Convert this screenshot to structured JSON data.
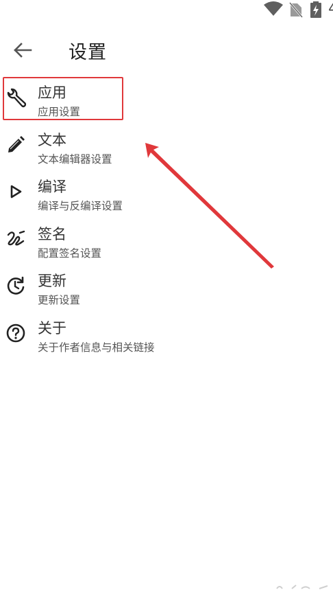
{
  "status_bar": {
    "battery_level_text": "4",
    "icons": [
      "wifi-icon",
      "no-sim-icon",
      "battery-charging-icon"
    ]
  },
  "app_bar": {
    "back_icon": "arrow-left-icon",
    "title": "设置"
  },
  "settings": {
    "items": [
      {
        "icon": "wrench-icon",
        "title": "应用",
        "subtitle": "应用设置"
      },
      {
        "icon": "pencil-icon",
        "title": "文本",
        "subtitle": "文本编辑器设置"
      },
      {
        "icon": "play-outline-icon",
        "title": "编译",
        "subtitle": "编译与反编译设置"
      },
      {
        "icon": "signature-icon",
        "title": "签名",
        "subtitle": "配置签名设置"
      },
      {
        "icon": "update-icon",
        "title": "更新",
        "subtitle": "更新设置"
      },
      {
        "icon": "help-circle-icon",
        "title": "关于",
        "subtitle": "关于作者信息与相关链接"
      }
    ]
  },
  "annotation": {
    "highlight_color": "#e0383b",
    "arrow_color": "#e0383b"
  }
}
